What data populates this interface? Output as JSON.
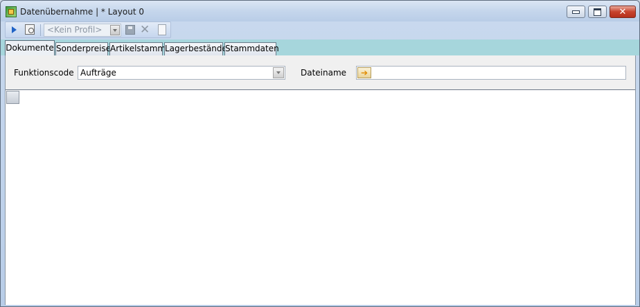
{
  "window": {
    "title": "Datenübernahme | * Layout 0"
  },
  "toolbar": {
    "profile_placeholder": "<Kein Profil>"
  },
  "tabs": [
    {
      "label": "Dokumente",
      "active": true
    },
    {
      "label": "Sonderpreise",
      "active": false
    },
    {
      "label": "Artikelstamm",
      "active": false
    },
    {
      "label": "Lagerbestände",
      "active": false
    },
    {
      "label": "Stammdaten",
      "active": false
    }
  ],
  "form": {
    "function_code_label": "Funktionscode",
    "function_code_value": "Aufträge",
    "filename_label": "Dateiname",
    "filename_value": ""
  },
  "icons": {
    "app": "import-grid-icon",
    "run": "play-icon",
    "preview": "preview-icon",
    "save": "save-icon",
    "delete": "delete-icon",
    "new": "new-document-icon",
    "browse": "arrow-right-icon"
  }
}
